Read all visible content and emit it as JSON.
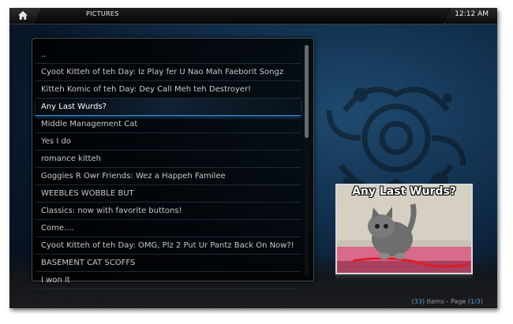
{
  "header": {
    "section": "PICTURES",
    "time": "12:12 AM"
  },
  "list": {
    "items": [
      {
        "label": ".."
      },
      {
        "label": "Cyoot Kitteh of teh Day: Iz Play fer U Nao Mah Faeborit Songz"
      },
      {
        "label": "Kitteh Komic of teh Day: Dey Call Meh teh Destroyer!"
      },
      {
        "label": "Any Last Wurds?",
        "selected": true
      },
      {
        "label": "Middle Management Cat"
      },
      {
        "label": "Yes I do"
      },
      {
        "label": "romance kitteh"
      },
      {
        "label": "Goggies R Owr Friends: Wez a Happeh Familee"
      },
      {
        "label": "WEEBLES WOBBLE BUT"
      },
      {
        "label": "Classics: now with favorite buttons!"
      },
      {
        "label": "Come...."
      },
      {
        "label": "Cyoot Kitteh of teh Day: OMG, Plz 2 Put Ur Pantz Back On Now?!"
      },
      {
        "label": "BASEMENT CAT SCOFFS"
      },
      {
        "label": "I won it"
      }
    ]
  },
  "preview": {
    "caption": "Any Last Wurds?"
  },
  "footer": {
    "count": "33",
    "items_text": "Items - Page",
    "page": "1/3"
  },
  "icons": {
    "home": "home-icon"
  },
  "colors": {
    "accent": "#3d8fd8"
  }
}
